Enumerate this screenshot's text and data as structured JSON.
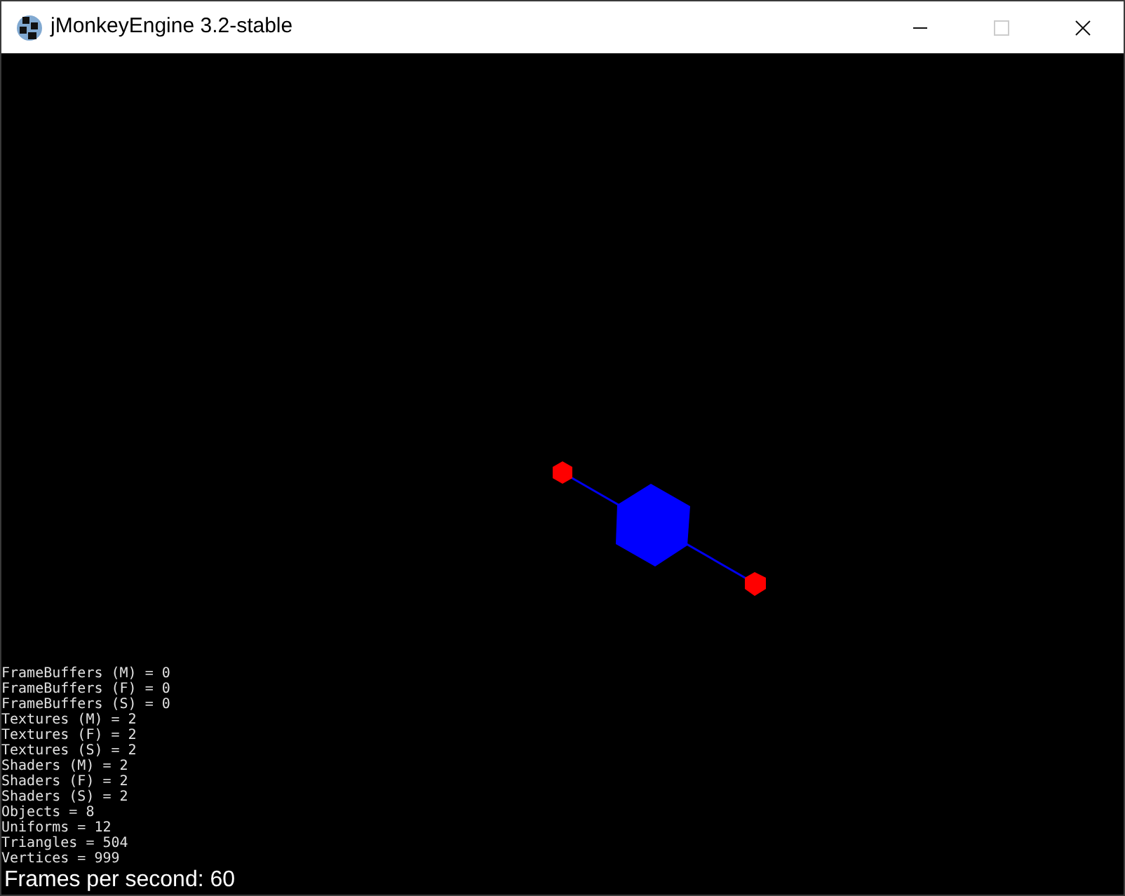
{
  "window": {
    "title": "jMonkeyEngine 3.2-stable",
    "controls": [
      {
        "kind": "minimize",
        "disabled": false
      },
      {
        "kind": "maximize",
        "disabled": true
      },
      {
        "kind": "close",
        "disabled": false
      }
    ]
  },
  "stats": [
    "FrameBuffers (M) = 0",
    "FrameBuffers (F) = 0",
    "FrameBuffers (S) = 0",
    "Textures (M) = 2",
    "Textures (F) = 2",
    "Textures (S) = 2",
    "Shaders (M) = 2",
    "Shaders (F) = 2",
    "Shaders (S) = 2",
    "Objects = 8",
    "Uniforms = 12",
    "Triangles = 504",
    "Vertices = 999"
  ],
  "fps": "Frames per second: 60"
}
